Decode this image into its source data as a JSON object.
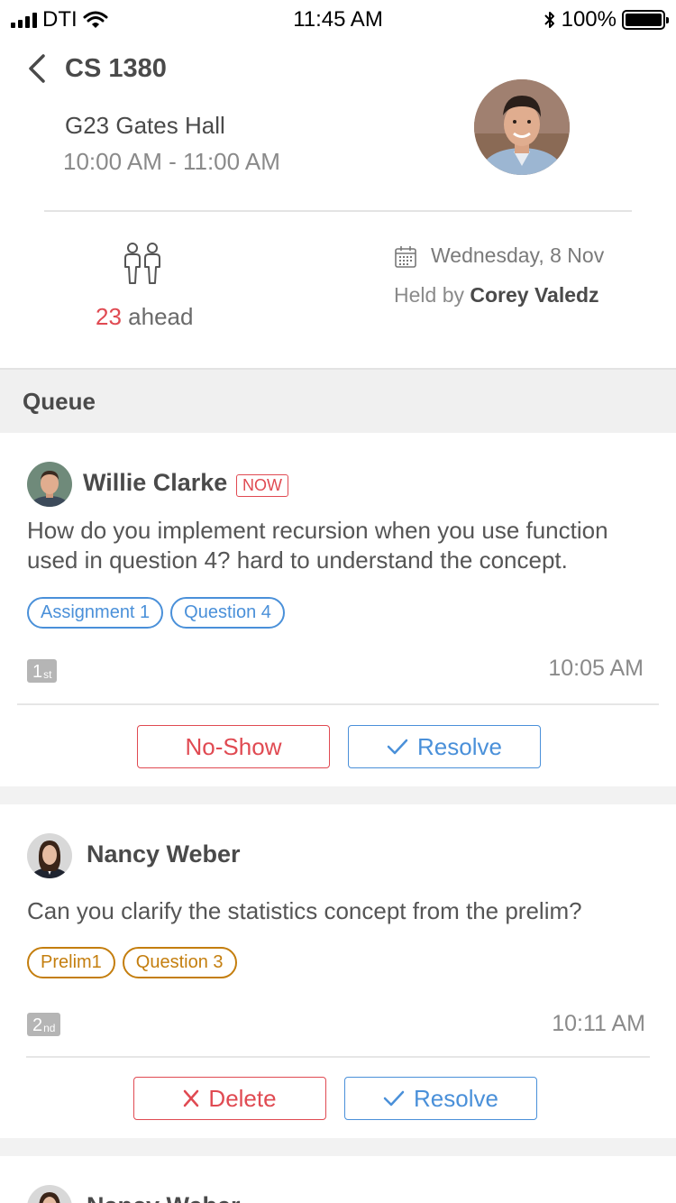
{
  "status_bar": {
    "carrier": "DTI",
    "time": "11:45 AM",
    "battery": "100%"
  },
  "header": {
    "course": "CS 1380",
    "location": "G23 Gates Hall",
    "time_range": "10:00 AM - 11:00 AM",
    "ahead_count": "23",
    "ahead_label": " ahead",
    "date": "Wednesday, 8 Nov",
    "held_by_label": "Held by ",
    "held_by_name": "Corey Valedz"
  },
  "queue": {
    "title": "Queue",
    "items": [
      {
        "name": "Willie Clarke",
        "badge": "NOW",
        "question": "How do you implement recursion when you use function used in question 4? hard to  understand the concept.",
        "tags": [
          "Assignment 1",
          "Question 4"
        ],
        "rank_num": "1",
        "rank_suffix": "st",
        "time": "10:05 AM",
        "left_button": "No-Show",
        "right_button": "Resolve"
      },
      {
        "name": "Nancy Weber",
        "question": "Can you clarify the statistics concept from the prelim?",
        "tags": [
          "Prelim1",
          "Question 3"
        ],
        "rank_num": "2",
        "rank_suffix": "nd",
        "time": "10:11 AM",
        "left_button": "Delete",
        "right_button": "Resolve"
      },
      {
        "name": "Nancy Weber"
      }
    ]
  },
  "colors": {
    "accent_red": "#e04a52",
    "accent_blue": "#4a90d9",
    "tag_orange": "#c47e0e"
  }
}
